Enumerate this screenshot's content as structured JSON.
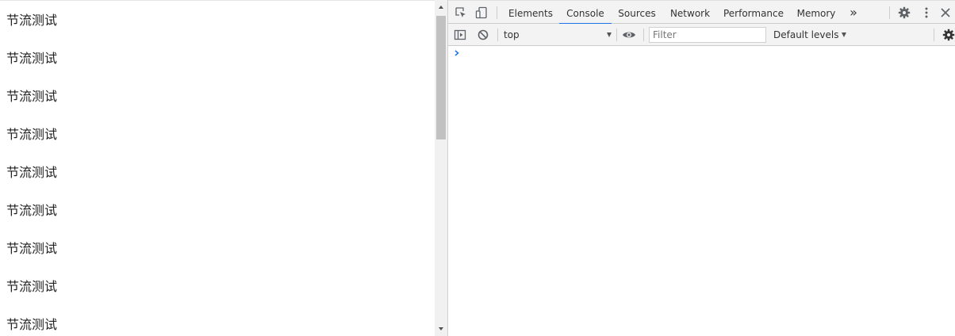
{
  "page": {
    "lines": [
      "节流测试",
      "节流测试",
      "节流测试",
      "节流测试",
      "节流测试",
      "节流测试",
      "节流测试",
      "节流测试",
      "节流测试"
    ]
  },
  "devtools": {
    "tabs": [
      {
        "label": "Elements",
        "active": false
      },
      {
        "label": "Console",
        "active": true
      },
      {
        "label": "Sources",
        "active": false
      },
      {
        "label": "Network",
        "active": false
      },
      {
        "label": "Performance",
        "active": false
      },
      {
        "label": "Memory",
        "active": false
      }
    ],
    "more_tabs_label": "»",
    "toolbar": {
      "context": "top",
      "filter_placeholder": "Filter",
      "filter_value": "",
      "levels": "Default levels"
    },
    "icons": {
      "inspect": "inspect-element-icon",
      "device": "device-toolbar-icon",
      "settings": "gear-icon",
      "menu": "kebab-menu-icon",
      "close": "close-icon",
      "sidebar": "console-sidebar-icon",
      "clear": "clear-console-icon",
      "live_expression": "eye-icon",
      "console_settings": "gear-icon",
      "prompt": "chevron-right-icon"
    },
    "colors": {
      "accent": "#1a73e8",
      "toolbar_bg": "#f3f3f3"
    }
  }
}
